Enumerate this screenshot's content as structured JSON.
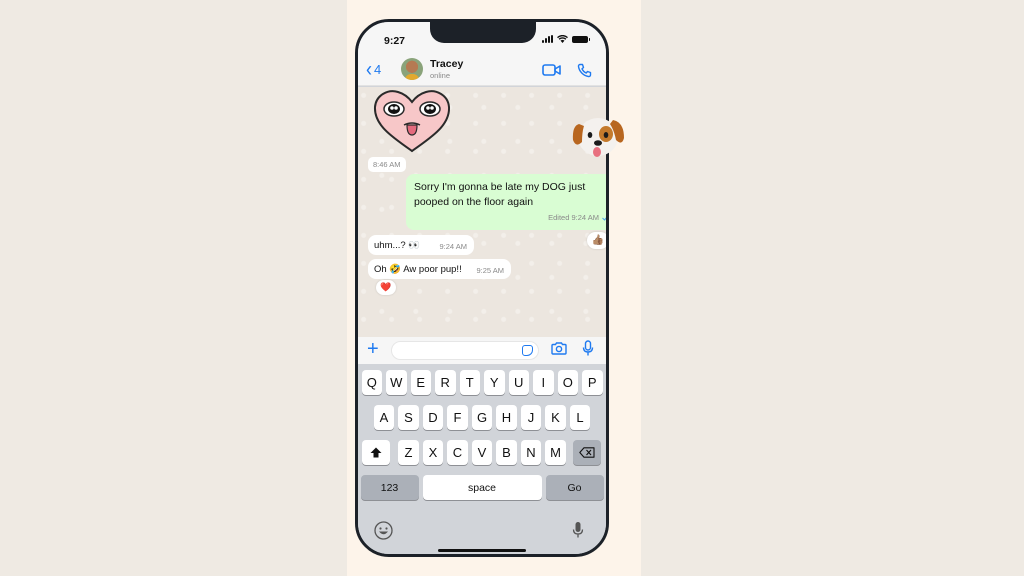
{
  "statusbar": {
    "time": "9:27"
  },
  "header": {
    "back_count": "4",
    "contact_name": "Tracey",
    "contact_status": "online"
  },
  "chat": {
    "date_stamp": "8:46 AM",
    "messages": [
      {
        "direction": "outgoing",
        "text": "Sorry I'm gonna be late my DOG just pooped on the floor again",
        "meta": "Edited 9:24 AM",
        "read": true,
        "reaction": "👍🏽"
      },
      {
        "direction": "incoming",
        "text": "uhm...? 👀",
        "time": "9:24 AM"
      },
      {
        "direction": "incoming",
        "text": "Oh 🤣 Aw poor pup!!",
        "time": "9:25 AM",
        "reaction": "❤️"
      }
    ],
    "stickers": [
      "heart-face-sticker",
      "dog-memoji-sticker"
    ]
  },
  "inputbar": {
    "message_value": "",
    "message_placeholder": ""
  },
  "keyboard": {
    "row1": [
      "Q",
      "W",
      "E",
      "R",
      "T",
      "Y",
      "U",
      "I",
      "O",
      "P"
    ],
    "row2": [
      "A",
      "S",
      "D",
      "F",
      "G",
      "H",
      "J",
      "K",
      "L"
    ],
    "row3": [
      "Z",
      "X",
      "C",
      "V",
      "B",
      "N",
      "M"
    ],
    "numbers_label": "123",
    "space_label": "space",
    "go_label": "Go"
  },
  "colors": {
    "accent": "#1f7af0",
    "outgoing_bubble": "#d9fdd3",
    "chat_background": "#ece6df"
  }
}
